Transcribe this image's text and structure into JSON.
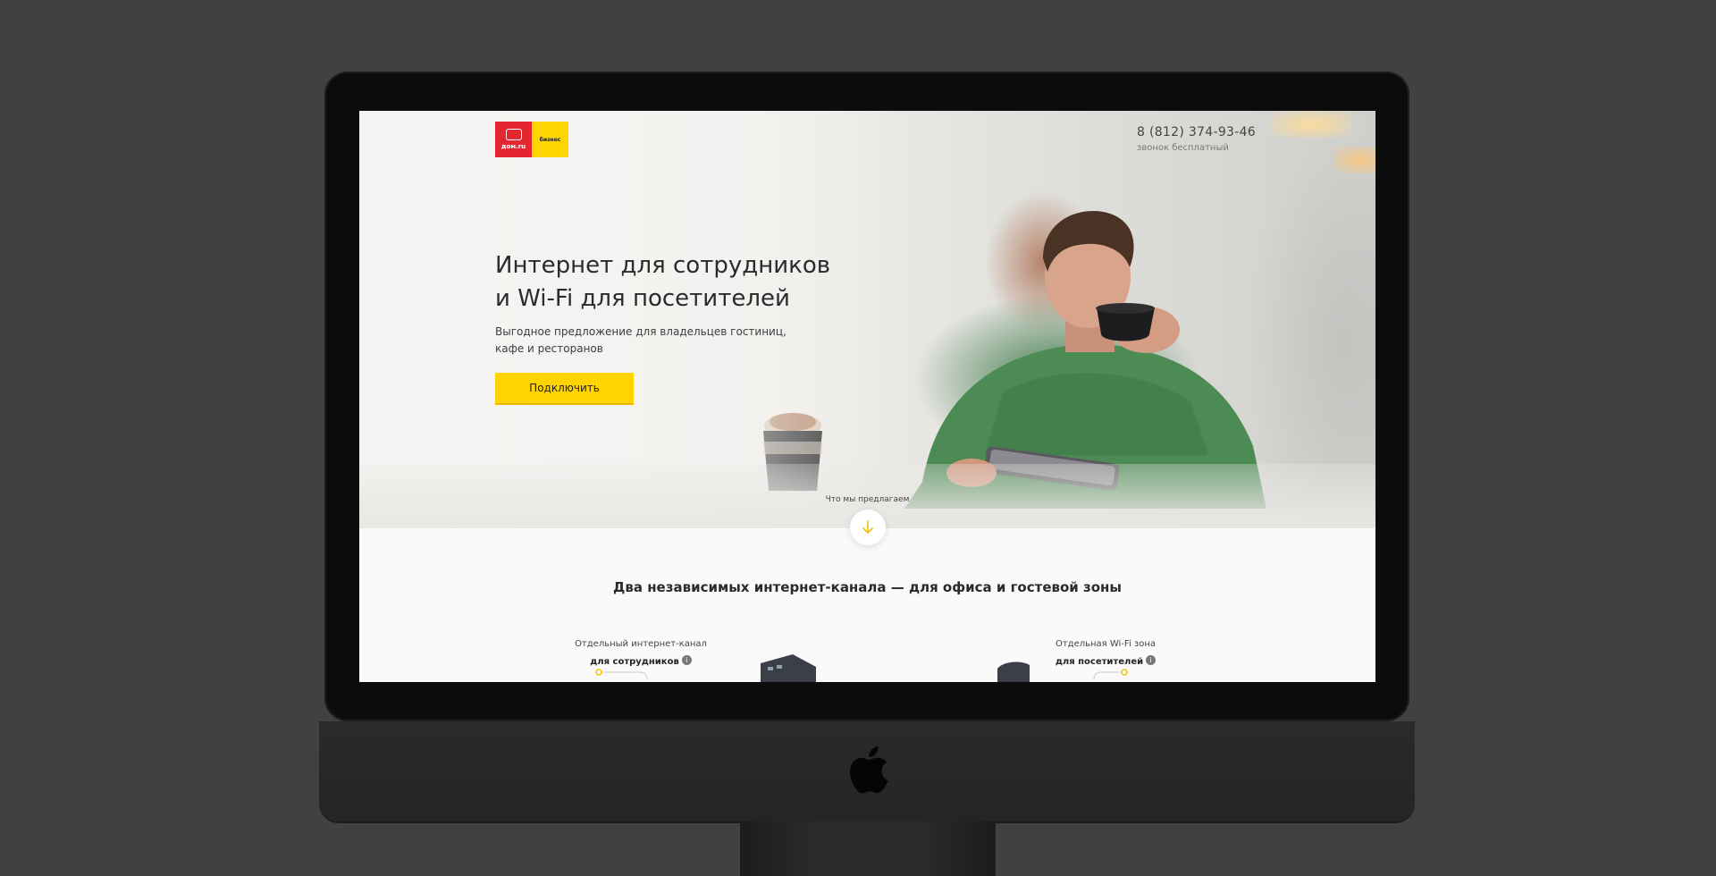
{
  "brand": {
    "logo_text": "дом.ru",
    "logo_sub": "бизнес",
    "primary_color": "#e3262f",
    "accent_color": "#ffd500"
  },
  "header": {
    "phone": "8 (812) 374-93-46",
    "phone_note": "звонок бесплатный"
  },
  "hero": {
    "title_line1": "Интернет для сотрудников",
    "title_line2": "и Wi-Fi для посетителей",
    "subtitle_line1": "Выгодное предложение для владельцев гостиниц,",
    "subtitle_line2": "кафе и ресторанов",
    "cta_label": "Подключить",
    "offer_label": "Что мы предлагаем"
  },
  "section": {
    "title": "Два независимых интернет-канала — для офиса и гостевой зоны"
  },
  "features": [
    {
      "caption": "Отдельный интернет-канал",
      "strong": "для сотрудников",
      "icon": "info-icon"
    },
    {
      "caption": "Отдельная Wi-Fi зона",
      "strong": "для посетителей",
      "icon": "info-icon"
    }
  ]
}
